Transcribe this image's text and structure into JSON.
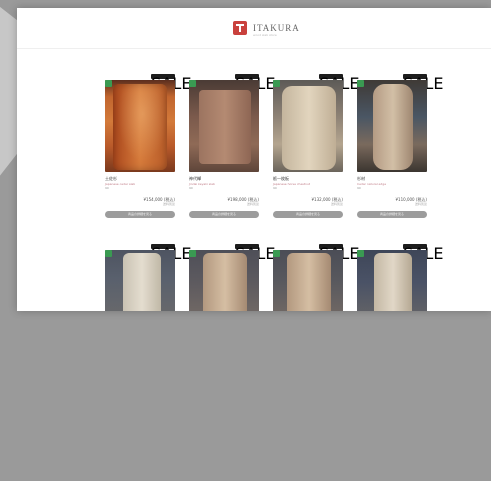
{
  "brand": {
    "name": "ITAKURA",
    "tagline": "wood slab store"
  },
  "products": [
    {
      "name": "土佐杉",
      "subtitle": "Japanese cedar slab",
      "meta": "90",
      "price": "¥154,000 (税込)",
      "ship": "送料別途",
      "badge": "SALE",
      "button": "商品の詳細を見る"
    },
    {
      "name": "神代欅",
      "subtitle": "Jindai keyaki slab",
      "meta": "90",
      "price": "¥198,000 (税込)",
      "ship": "送料別途",
      "badge": "SALE",
      "button": "商品の詳細を見る"
    },
    {
      "name": "栃一枚板",
      "subtitle": "Japanese horse chestnut",
      "meta": "90",
      "price": "¥132,000 (税込)",
      "ship": "送料別途",
      "badge": "SALE",
      "button": "商品の詳細を見る"
    },
    {
      "name": "杉材",
      "subtitle": "Cedar natural edge",
      "meta": "90",
      "price": "¥110,000 (税込)",
      "ship": "送料別途",
      "badge": "SALE",
      "button": "商品の詳細を見る"
    },
    {
      "badge": "SALE"
    },
    {
      "badge": "SALE"
    },
    {
      "badge": "SALE"
    },
    {
      "badge": "SALE"
    }
  ]
}
